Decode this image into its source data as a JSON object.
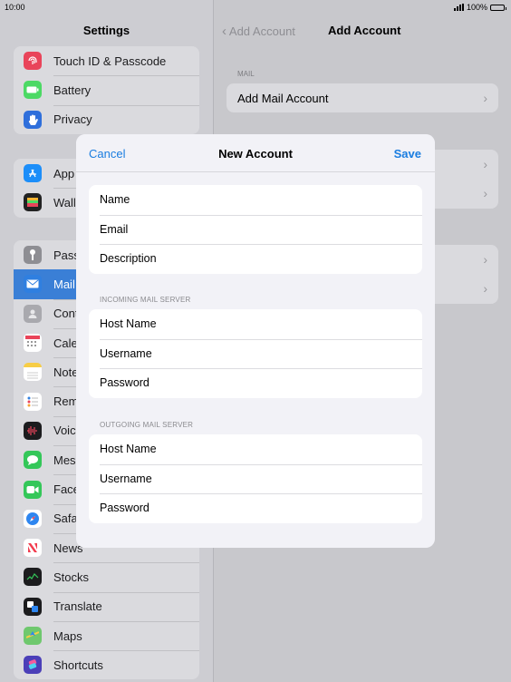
{
  "status": {
    "time": "10:00",
    "battery": "100%"
  },
  "sidebar": {
    "title": "Settings",
    "group1": [
      {
        "label": "Touch ID & Passcode",
        "icon": "fingerprint-icon",
        "color": "#e9445a"
      },
      {
        "label": "Battery",
        "icon": "battery-icon",
        "color": "#4cd964"
      },
      {
        "label": "Privacy",
        "icon": "hand-icon",
        "color": "#2f6fdb"
      }
    ],
    "group2": [
      {
        "label": "App",
        "icon": "app-store-icon",
        "color": "#1c8ef9"
      },
      {
        "label": "Walle",
        "icon": "wallet-icon",
        "color": "#222222"
      }
    ],
    "group3": [
      {
        "label": "Pass",
        "icon": "key-icon",
        "color": "#8e8e93"
      },
      {
        "label": "Mail",
        "icon": "mail-icon",
        "color": "#2f7fe0",
        "selected": true
      },
      {
        "label": "Cont",
        "icon": "contacts-icon",
        "color": "#a9a9ae"
      },
      {
        "label": "Cale",
        "icon": "calendar-icon",
        "color": "#ffffff"
      },
      {
        "label": "Note",
        "icon": "notes-icon",
        "color": "#f7cd46"
      },
      {
        "label": "Rem",
        "icon": "reminders-icon",
        "color": "#ffffff"
      },
      {
        "label": "Voic",
        "icon": "voice-memos-icon",
        "color": "#1c1c1e"
      },
      {
        "label": "Mess",
        "icon": "messages-icon",
        "color": "#34c759"
      },
      {
        "label": "Face",
        "icon": "facetime-icon",
        "color": "#34c759"
      },
      {
        "label": "Safa",
        "icon": "safari-icon",
        "color": "#2e86f0"
      },
      {
        "label": "News",
        "icon": "news-icon",
        "color": "#ffffff"
      },
      {
        "label": "Stocks",
        "icon": "stocks-icon",
        "color": "#1c1c1e"
      },
      {
        "label": "Translate",
        "icon": "translate-icon",
        "color": "#1c1c1e"
      },
      {
        "label": "Maps",
        "icon": "maps-icon",
        "color": "#6fc86e"
      },
      {
        "label": "Shortcuts",
        "icon": "shortcuts-icon",
        "color": "#4b3fb8"
      }
    ]
  },
  "detail": {
    "back_label": "Add Account",
    "title": "Add Account",
    "section_label": "MAIL",
    "add_mail_label": "Add Mail Account"
  },
  "modal": {
    "cancel_label": "Cancel",
    "title": "New Account",
    "save_label": "Save",
    "account_fields": [
      "Name",
      "Email",
      "Description"
    ],
    "incoming_header": "INCOMING MAIL SERVER",
    "incoming_fields": [
      "Host Name",
      "Username",
      "Password"
    ],
    "outgoing_header": "OUTGOING MAIL SERVER",
    "outgoing_fields": [
      "Host Name",
      "Username",
      "Password"
    ]
  }
}
